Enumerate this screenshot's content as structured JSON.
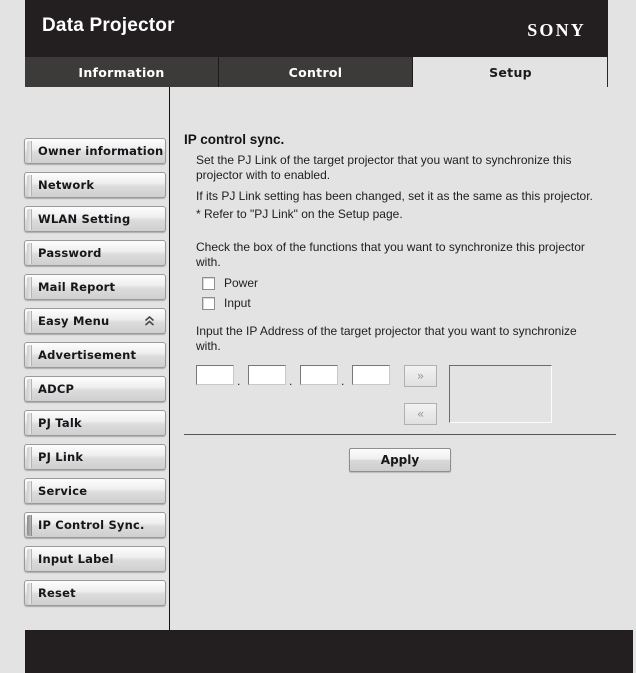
{
  "header": {
    "title": "Data Projector",
    "brand": "SONY"
  },
  "tabs": [
    {
      "label": "Information",
      "active": false
    },
    {
      "label": "Control",
      "active": false
    },
    {
      "label": "Setup",
      "active": true
    }
  ],
  "sidebar": {
    "items": [
      {
        "label": "Owner information",
        "selected": false,
        "icon": ""
      },
      {
        "label": "Network",
        "selected": false,
        "icon": ""
      },
      {
        "label": "WLAN Setting",
        "selected": false,
        "icon": ""
      },
      {
        "label": "Password",
        "selected": false,
        "icon": ""
      },
      {
        "label": "Mail Report",
        "selected": false,
        "icon": ""
      },
      {
        "label": "Easy Menu",
        "selected": false,
        "icon": "double-chevron-up-icon"
      },
      {
        "label": "Advertisement",
        "selected": false,
        "icon": ""
      },
      {
        "label": "ADCP",
        "selected": false,
        "icon": ""
      },
      {
        "label": "PJ Talk",
        "selected": false,
        "icon": ""
      },
      {
        "label": "PJ Link",
        "selected": false,
        "icon": ""
      },
      {
        "label": "Service",
        "selected": false,
        "icon": ""
      },
      {
        "label": "IP Control Sync.",
        "selected": true,
        "icon": ""
      },
      {
        "label": "Input Label",
        "selected": false,
        "icon": ""
      },
      {
        "label": "Reset",
        "selected": false,
        "icon": ""
      }
    ]
  },
  "main": {
    "section_title": "IP control sync.",
    "paragraph_1": "Set the PJ Link of the target projector that you want to synchronize this projector with to enabled.",
    "paragraph_2": "If its PJ Link setting has been changed, set it as the same as this projector.",
    "paragraph_3": "* Refer to \"PJ Link\" on the Setup page.",
    "checkbox_intro": "Check the box of the functions that you want to synchronize this projector with.",
    "checkboxes": [
      {
        "label": "Power",
        "checked": false
      },
      {
        "label": "Input",
        "checked": false
      }
    ],
    "ip_intro": "Input the IP Address of the target projector that you want to synchronize with.",
    "ip_fields": [
      {
        "value": "",
        "placeholder": ""
      },
      {
        "value": "",
        "placeholder": ""
      },
      {
        "value": "",
        "placeholder": ""
      },
      {
        "value": "",
        "placeholder": ""
      }
    ],
    "ip_separator": ".",
    "add_button_label": "»",
    "remove_button_label": "«",
    "ip_list_items": [],
    "apply_label": "Apply"
  },
  "colors": {
    "header_bg": "#231f20",
    "page_bg": "#e3e3e3",
    "tab_inactive_bg": "#3d3a3a",
    "tab_active_bg": "#e3e3e3",
    "text": "#1e1e1e"
  }
}
